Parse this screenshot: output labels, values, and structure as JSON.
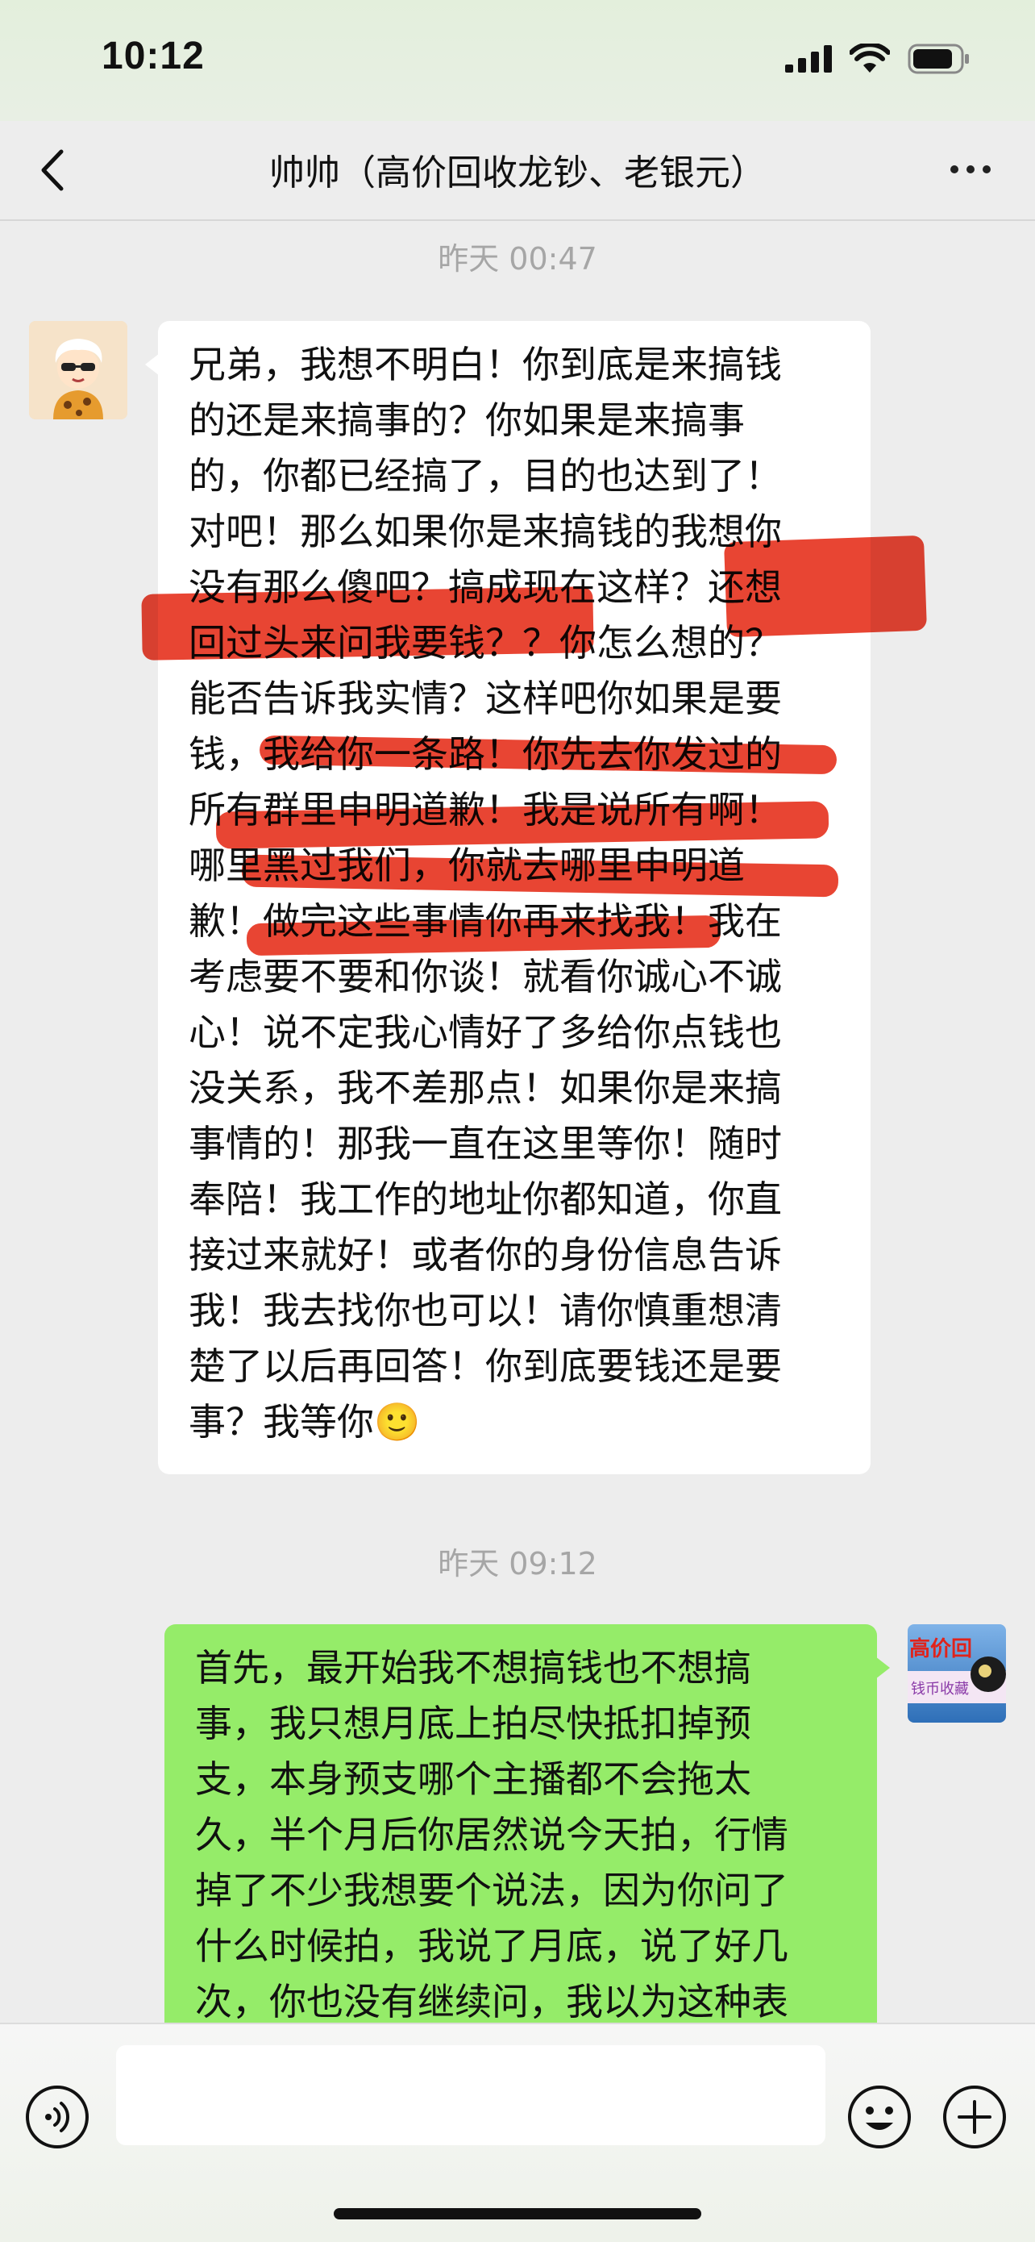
{
  "status_bar": {
    "time": "10:12"
  },
  "header": {
    "title": "帅帅（高价回收龙钞、老银元）"
  },
  "messages": {
    "ts1": "昨天 00:47",
    "msg1_lines": [
      "兄弟，我想不明白！你到底是来搞钱",
      "的还是来搞事的？你如果是来搞事",
      "的，你都已经搞了，目的也达到了！",
      "对吧！那么如果你是来搞钱的我想你",
      "没有那么傻吧？搞成现在这样？还想",
      "回过头来问我要钱？？你怎么想的？",
      "能否告诉我实情？这样吧你如果是要",
      "钱，我给你一条路！你先去你发过的",
      "所有群里申明道歉！我是说所有啊！",
      "哪里黑过我们，你就去哪里申明道",
      "歉！做完这些事情你再来找我！我在",
      "考虑要不要和你谈！就看你诚心不诚",
      "心！说不定我心情好了多给你点钱也",
      "没关系，我不差那点！如果你是来搞",
      "事情的！那我一直在这里等你！随时",
      "奉陪！我工作的地址你都知道，你直",
      "接过来就好！或者你的身份信息告诉",
      "我！我去找你也可以！请你慎重想清",
      "楚了以后再回答！你到底要钱还是要",
      "事？我等你🙂"
    ],
    "ts2": "昨天 09:12",
    "msg2_lines": [
      "首先，最开始我不想搞钱也不想搞",
      "事，我只想月底上拍尽快抵扣掉预",
      "支，本身预支哪个主播都不会拖太",
      "久，半个月后你居然说今天拍，行情",
      "掉了不少我想要个说法，因为你问了",
      "什么时候拍，我说了月底，说了好几",
      "次，你也没有继续问，我以为这种表"
    ],
    "avatar_right_text_top": "高价回",
    "avatar_right_text_bottom": "钱币收藏"
  },
  "input": {
    "placeholder": ""
  },
  "colors": {
    "bubble_self": "#95ec69",
    "bubble_other": "#ffffff",
    "highlight_red": "#e42612"
  },
  "icons": [
    "back-chevron-icon",
    "more-dots-icon",
    "voice-icon",
    "emoji-icon",
    "plus-icon",
    "signal-icon",
    "wifi-icon",
    "battery-icon"
  ]
}
